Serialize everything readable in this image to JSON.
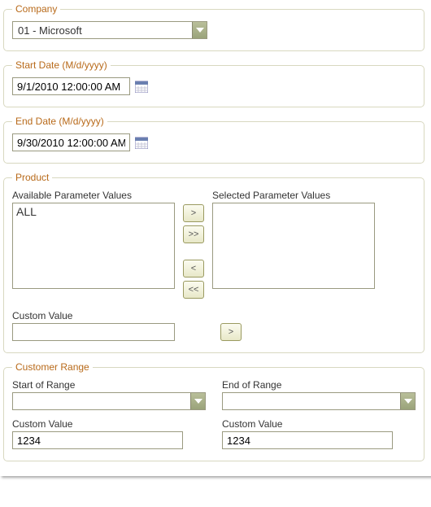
{
  "company": {
    "legend": "Company",
    "value": "01 - Microsoft"
  },
  "start_date": {
    "legend": "Start Date (M/d/yyyy)",
    "value": "9/1/2010 12:00:00 AM"
  },
  "end_date": {
    "legend": "End Date (M/d/yyyy)",
    "value": "9/30/2010 12:00:00 AM"
  },
  "product": {
    "legend": "Product",
    "available_label": "Available Parameter Values",
    "selected_label": "Selected Parameter Values",
    "available_items": [
      "ALL"
    ],
    "selected_items": [],
    "btn_add": ">",
    "btn_add_all": ">>",
    "btn_remove": "<",
    "btn_remove_all": "<<",
    "custom_label": "Custom Value",
    "custom_value": "",
    "btn_custom_add": ">"
  },
  "customer_range": {
    "legend": "Customer Range",
    "start_label": "Start of Range",
    "end_label": "End of Range",
    "start_value": "",
    "end_value": "",
    "custom_label_left": "Custom Value",
    "custom_label_right": "Custom Value",
    "custom_value_left": "1234",
    "custom_value_right": "1234"
  },
  "icons": {
    "dropdown": "chevron-down-icon",
    "calendar": "calendar-icon"
  }
}
